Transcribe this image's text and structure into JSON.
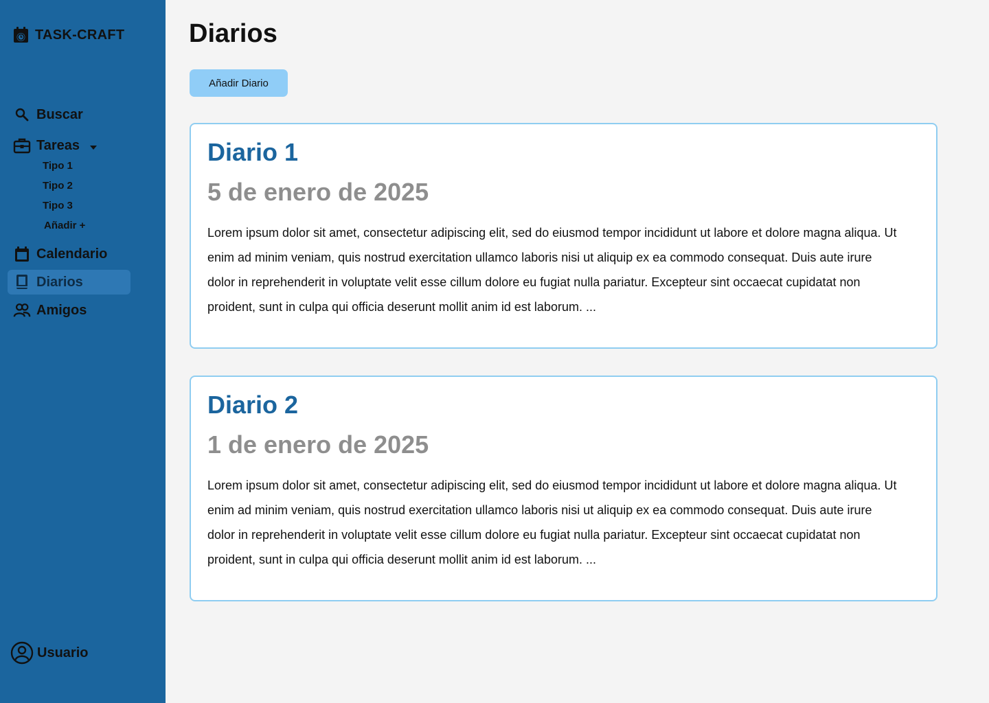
{
  "app": {
    "brand": "TASK-CRAFT"
  },
  "sidebar": {
    "items": [
      {
        "label": "Buscar",
        "icon": "search-icon"
      },
      {
        "label": "Tareas",
        "icon": "briefcase-icon"
      },
      {
        "label": "Calendario",
        "icon": "calendar-icon"
      },
      {
        "label": "Diarios",
        "icon": "book-icon",
        "active": true
      },
      {
        "label": "Amigos",
        "icon": "friends-icon"
      }
    ],
    "subitems": [
      "Tipo 1",
      "Tipo 2",
      "Tipo 3",
      "Añadir +"
    ],
    "user": {
      "label": "Usuario",
      "icon": "user-circle-icon"
    }
  },
  "main": {
    "title": "Diarios",
    "add_button": "Añadir Diario",
    "entries": [
      {
        "title": "Diario 1",
        "date": "5 de enero de 2025",
        "body": "Lorem ipsum dolor sit amet, consectetur adipiscing elit, sed do eiusmod tempor incididunt ut labore et dolore magna aliqua. Ut enim ad minim veniam, quis nostrud exercitation ullamco laboris nisi ut aliquip ex ea commodo consequat. Duis aute irure dolor in reprehenderit in voluptate velit esse cillum dolore eu fugiat nulla pariatur. Excepteur sint occaecat cupidatat non proident, sunt in culpa qui officia deserunt mollit anim id est laborum. ..."
      },
      {
        "title": "Diario 2",
        "date": "1 de enero de 2025",
        "body": "Lorem ipsum dolor sit amet, consectetur adipiscing elit, sed do eiusmod tempor incididunt ut labore et dolore magna aliqua. Ut enim ad minim veniam, quis nostrud exercitation ullamco laboris nisi ut aliquip ex ea commodo consequat. Duis aute irure dolor in reprehenderit in voluptate velit esse cillum dolore eu fugiat nulla pariatur. Excepteur sint occaecat cupidatat non proident, sunt in culpa qui officia deserunt mollit anim id est laborum. ..."
      }
    ]
  },
  "colors": {
    "sidebar": "#1b659e",
    "active_item": "#2e78b4",
    "button": "#90cdf7",
    "card_border": "#8fcdf1",
    "entry_title": "#1b659e",
    "entry_date": "#8e8e8e",
    "background": "#f4f4f4"
  }
}
